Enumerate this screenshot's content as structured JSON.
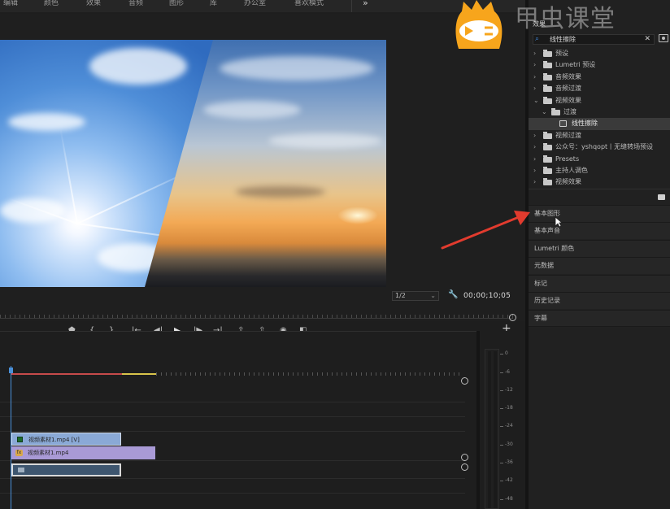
{
  "workspace": {
    "tabs": [
      "编辑",
      "颜色",
      "效果",
      "音频",
      "图形",
      "库",
      "办公室",
      "喜欢模式"
    ],
    "overflow": "»"
  },
  "monitor": {
    "zoom": "1/2",
    "timecode": "00;00;10;05"
  },
  "effects": {
    "title": "效果",
    "search_value": "线性擦除",
    "tree": [
      {
        "label": "预设",
        "level": 0,
        "expanded": false,
        "icon": "folder-icon"
      },
      {
        "label": "Lumetri 预设",
        "level": 0,
        "expanded": false,
        "icon": "folder-icon"
      },
      {
        "label": "音频效果",
        "level": 0,
        "expanded": false,
        "icon": "folder-icon"
      },
      {
        "label": "音频过渡",
        "level": 0,
        "expanded": false,
        "icon": "folder-icon"
      },
      {
        "label": "视频效果",
        "level": 0,
        "expanded": true,
        "icon": "folder-icon"
      },
      {
        "label": "过渡",
        "level": 1,
        "expanded": true,
        "icon": "folder-icon"
      },
      {
        "label": "线性擦除",
        "level": 2,
        "expanded": false,
        "icon": "effect-icon",
        "selected": true
      },
      {
        "label": "视频过渡",
        "level": 0,
        "expanded": false,
        "icon": "folder-icon"
      },
      {
        "label": "公众号：yshqopt丨无缝转场预设",
        "level": 0,
        "expanded": false,
        "icon": "folder-icon"
      },
      {
        "label": "Presets",
        "level": 0,
        "expanded": false,
        "icon": "folder-icon"
      },
      {
        "label": "主持人调色",
        "level": 0,
        "expanded": false,
        "icon": "folder-icon"
      },
      {
        "label": "视频效果",
        "level": 0,
        "expanded": false,
        "icon": "folder-icon"
      }
    ]
  },
  "panels": [
    "基本图形",
    "基本声音",
    "Lumetri 颜色",
    "元数据",
    "标记",
    "历史记录",
    "字幕"
  ],
  "timeline": {
    "clips": {
      "video": "视频素材1.mp4 [V]",
      "audio": "视频素材1.mp4"
    }
  },
  "meter": {
    "ticks": [
      "0",
      "-6",
      "-12",
      "-18",
      "-24",
      "-30",
      "-36",
      "-42",
      "-48"
    ]
  },
  "brand": {
    "text": "甲虫课堂"
  },
  "colors": {
    "arrow": "#e23b2e",
    "playhead": "#4a90d9",
    "video_clip": "#8aa9d6",
    "audio_clip": "#a99ad6",
    "logo": "#f7a51c"
  }
}
